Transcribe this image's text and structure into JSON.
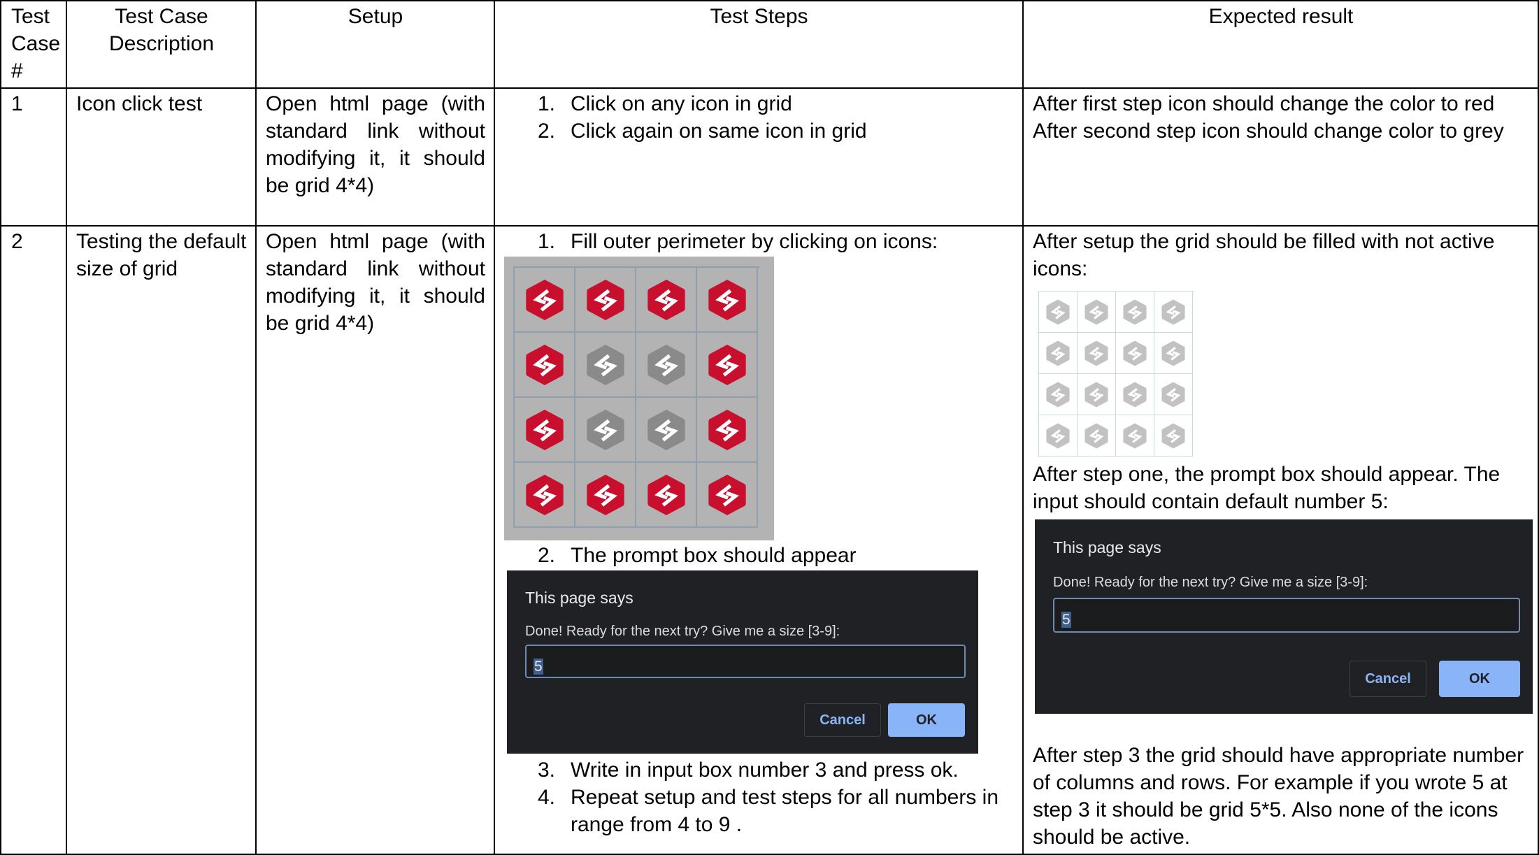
{
  "headers": {
    "num": "Test Case #",
    "desc": "Test Case Description",
    "setup": "Setup",
    "steps": "Test Steps",
    "expected": "Expected result"
  },
  "row1": {
    "num": "1",
    "desc": "Icon click test",
    "setup": "Open html page (with standard link without modifying it, it should be grid 4*4)",
    "steps": [
      {
        "n": "1.",
        "text": "Click on any icon in grid"
      },
      {
        "n": "2.",
        "text": "Click again on same icon in grid"
      }
    ],
    "expected_line1": "After first step icon should change the color to red",
    "expected_line2": "After second step icon should change color to grey"
  },
  "row2": {
    "num": "2",
    "desc": "Testing the default size of grid",
    "setup": "Open html page (with standard link without modifying it, it should be grid 4*4)",
    "step1": {
      "n": "1.",
      "text": "Fill outer perimeter by clicking on icons:"
    },
    "step2": {
      "n": "2.",
      "text": "The prompt box should appear"
    },
    "step3": {
      "n": "3.",
      "text": "Write in input box number 3 and press ok."
    },
    "step4": {
      "n": "4.",
      "text": "Repeat setup and test steps for all numbers in range from 4 to 9 ."
    },
    "expected_a": "After setup the grid should be filled with not active icons:",
    "expected_b": "After step one, the prompt box should appear. The input should contain default number 5:",
    "expected_c": "After step 3 the grid should have appropriate number of columns and rows. For example if you wrote 5 at step 3 it should be grid 5*5. Also none of the icons should be active."
  },
  "grid_states": [
    [
      "red",
      "red",
      "red",
      "red"
    ],
    [
      "red",
      "grey",
      "grey",
      "red"
    ],
    [
      "red",
      "grey",
      "grey",
      "red"
    ],
    [
      "red",
      "red",
      "red",
      "red"
    ]
  ],
  "colors": {
    "red": "#c8102e",
    "grey": "#8a8a8a",
    "light_grey": "#c2c2c2"
  },
  "icon_name": "hexagon-arrows-icon",
  "dialog": {
    "title": "This page says",
    "message": "Done! Ready for the next try? Give me a size [3-9]:",
    "value": "5",
    "cancel": "Cancel",
    "ok": "OK"
  }
}
